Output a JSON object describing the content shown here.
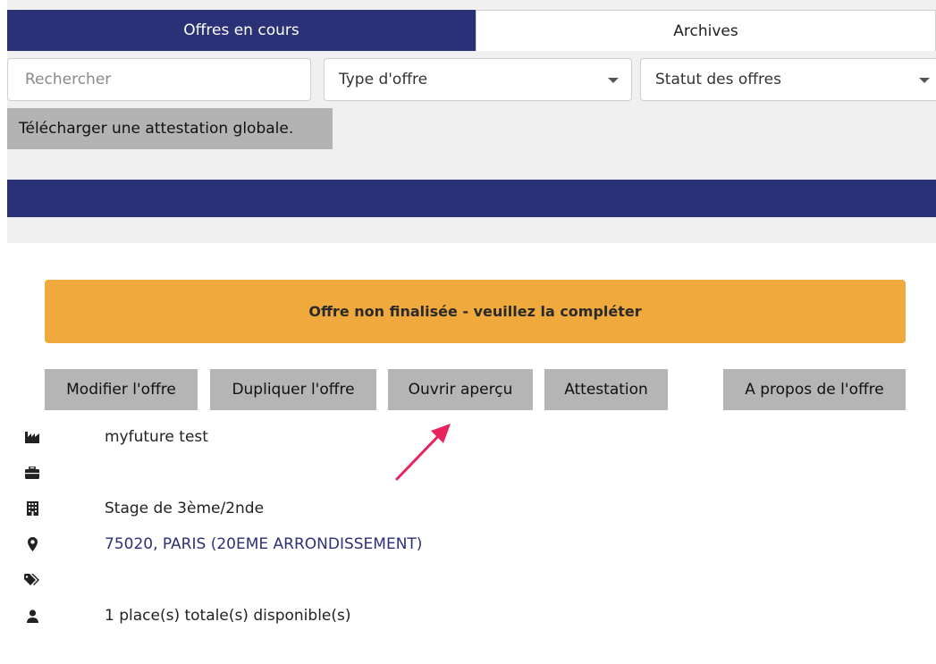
{
  "tabs": [
    {
      "label": "Offres en cours",
      "active": true
    },
    {
      "label": "Archives",
      "active": false
    }
  ],
  "filters": {
    "search_placeholder": "Rechercher",
    "type_label": "Type d'offre",
    "status_label": "Statut des offres"
  },
  "global_attestation_label": "Télécharger une attestation globale.",
  "offer": {
    "alert": "Offre non finalisée - veuillez la compléter",
    "actions": {
      "modify": "Modifier l'offre",
      "duplicate": "Dupliquer l'offre",
      "preview": "Ouvrir aperçu",
      "attestation": "Attestation",
      "about": "A propos de l'offre"
    },
    "details": {
      "company": "myfuture test",
      "offer_type": "Stage de 3ème/2nde",
      "location": "75020, PARIS (20EME ARRONDISSEMENT)",
      "places": "1 place(s) totale(s) disponible(s)"
    }
  },
  "icons": {
    "company": "factory-icon",
    "job": "briefcase-icon",
    "building": "building-icon",
    "location": "map-marker-icon",
    "tags": "tags-icon",
    "places": "user-icon",
    "annotation": "arrow-annotation-icon"
  },
  "colors": {
    "navy": "#2b3176",
    "alert": "#f0a93c",
    "button_gray": "#b5b5b5",
    "arrow": "#e8245e"
  }
}
